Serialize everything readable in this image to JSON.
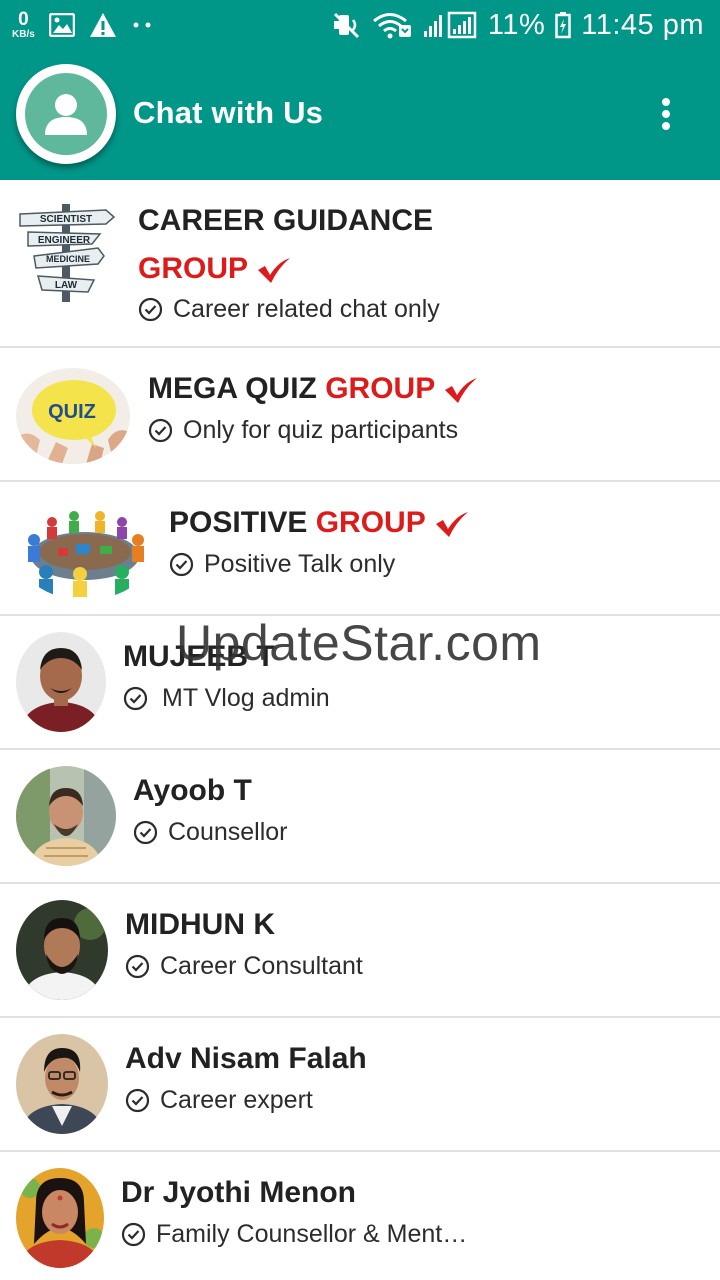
{
  "status_bar": {
    "net_speed": "0",
    "net_unit": "KB/s",
    "battery": "11%",
    "time": "11:45 pm",
    "icons": [
      "image-icon",
      "warning-icon",
      "dots-icon",
      "mute-icon",
      "wifi-icon",
      "signal-icon",
      "battery-icon"
    ]
  },
  "app_bar": {
    "title": "Chat with Us",
    "background": "#009688"
  },
  "contacts": [
    {
      "title_black": "CAREER GUIDANCE",
      "title_red": "GROUP",
      "subtitle": "Career related chat only",
      "verified": true
    },
    {
      "title_black": "MEGA QUIZ ",
      "title_red": "GROUP",
      "subtitle": "Only for quiz participants",
      "verified": true
    },
    {
      "title_black": "POSITIVE ",
      "title_red": "GROUP",
      "subtitle": "Positive Talk only",
      "verified": true
    },
    {
      "title_black": "MUJEEB T",
      "subtitle": "MT Vlog admin"
    },
    {
      "title_black": "Ayoob T",
      "subtitle": "Counsellor"
    },
    {
      "title_black": "MIDHUN K",
      "subtitle": "Career Consultant"
    },
    {
      "title_black": "Adv Nisam Falah",
      "subtitle": "Career expert"
    },
    {
      "title_black": "Dr Jyothi Menon",
      "subtitle": "Family Counsellor & Ment…"
    }
  ],
  "signpost_words": [
    "SCIENTIST",
    "ENGINEER",
    "MEDICINE",
    "LAW"
  ],
  "quiz_badge": "QUIZ",
  "watermark": "UpdateStar.com",
  "colors": {
    "accent": "#009688",
    "red": "#dd1b1b",
    "divider": "#e1e1e1"
  }
}
